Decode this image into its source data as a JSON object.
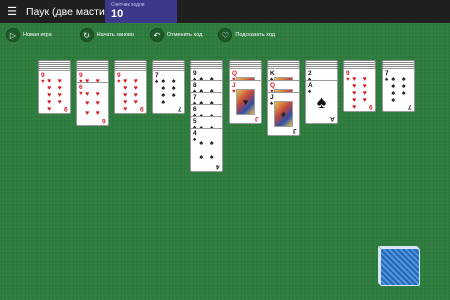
{
  "topbar": {
    "menu_icon": "hamburger-menu-icon",
    "title": "Паук (две масти)",
    "counter_label": "Счетчик ходов",
    "counter_value": "10"
  },
  "toolbar": {
    "new_game": "Новая игра",
    "restart": "Начать заново",
    "undo": "Отменить ход",
    "hint": "Подсказать ход"
  },
  "colors": {
    "felt": "#2f7d3f",
    "topbar": "#1f1f1f",
    "counter_bg": "#3b3a8a",
    "red_suit": "#d4202a",
    "black_suit": "#111111",
    "stock_back": "#2e78c9"
  },
  "tableau": [
    {
      "facedown": 5,
      "cards": [
        {
          "rank": "9",
          "suit": "♥",
          "color": "red"
        }
      ]
    },
    {
      "facedown": 5,
      "cards": [
        {
          "rank": "9",
          "suit": "♥",
          "color": "red"
        },
        {
          "rank": "6",
          "suit": "♥",
          "color": "red"
        }
      ]
    },
    {
      "facedown": 5,
      "cards": [
        {
          "rank": "9",
          "suit": "♥",
          "color": "red"
        }
      ]
    },
    {
      "facedown": 5,
      "cards": [
        {
          "rank": "7",
          "suit": "♠",
          "color": "black"
        }
      ]
    },
    {
      "facedown": 4,
      "cards": [
        {
          "rank": "9",
          "suit": "♠",
          "color": "black"
        },
        {
          "rank": "8",
          "suit": "♠",
          "color": "black"
        },
        {
          "rank": "7",
          "suit": "♠",
          "color": "black"
        },
        {
          "rank": "6",
          "suit": "♠",
          "color": "black"
        },
        {
          "rank": "5",
          "suit": "♠",
          "color": "black"
        },
        {
          "rank": "4",
          "suit": "♠",
          "color": "black"
        }
      ]
    },
    {
      "facedown": 4,
      "cards": [
        {
          "rank": "Q",
          "suit": "♥",
          "color": "red"
        },
        {
          "rank": "J",
          "suit": "♥",
          "color": "red"
        }
      ]
    },
    {
      "facedown": 4,
      "cards": [
        {
          "rank": "K",
          "suit": "♠",
          "color": "black"
        },
        {
          "rank": "Q",
          "suit": "♥",
          "color": "red"
        },
        {
          "rank": "J",
          "suit": "♠",
          "color": "black"
        }
      ]
    },
    {
      "facedown": 4,
      "cards": [
        {
          "rank": "2",
          "suit": "♠",
          "color": "black"
        },
        {
          "rank": "A",
          "suit": "♠",
          "color": "black"
        }
      ]
    },
    {
      "facedown": 4,
      "cards": [
        {
          "rank": "9",
          "suit": "♥",
          "color": "red"
        }
      ]
    },
    {
      "facedown": 4,
      "cards": [
        {
          "rank": "7",
          "suit": "♠",
          "color": "black"
        }
      ]
    }
  ],
  "stock": {
    "piles": 5
  }
}
